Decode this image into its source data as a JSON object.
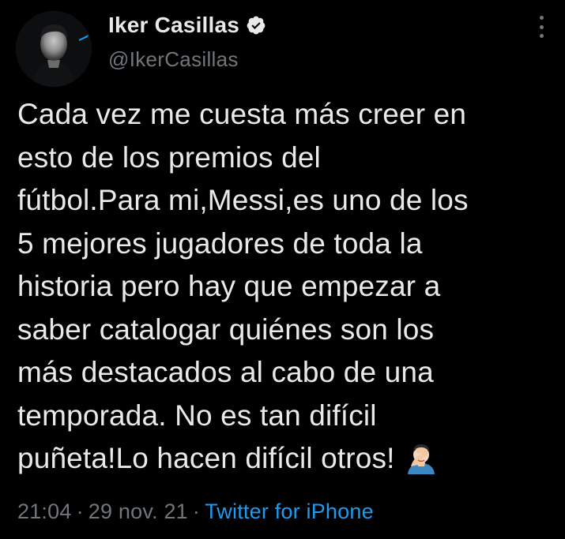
{
  "tweet": {
    "author": {
      "display_name": "Iker Casillas",
      "handle": "@IkerCasillas",
      "verified": true
    },
    "text_lines": [
      "Cada vez me cuesta más creer en",
      "esto de los premios del",
      "fútbol.Para mi,Messi,es uno de los",
      "5 mejores jugadores de toda la",
      "historia pero hay que empezar a",
      "saber catalogar quiénes son los",
      "más destacados al cabo de una",
      "temporada. No es tan difícil",
      "puñeta!Lo hacen difícil otros!"
    ],
    "emoji": "person-facepalming",
    "time": "21:04",
    "date": "29 nov. 21",
    "source": "Twitter for iPhone",
    "separator": "·"
  },
  "icons": {
    "more": "more-vertical-icon",
    "verified": "verified-badge-icon"
  },
  "colors": {
    "background": "#000000",
    "text": "#e7e9ea",
    "secondary": "#71767b",
    "link": "#1d9bf0"
  }
}
